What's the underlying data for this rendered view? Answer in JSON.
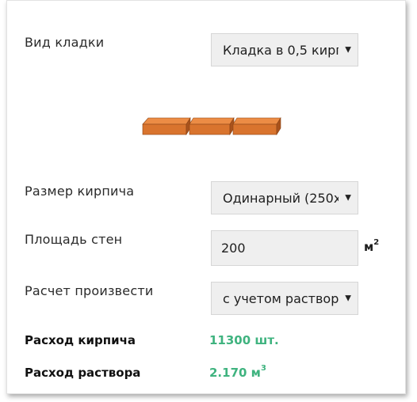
{
  "form": {
    "masonry_type": {
      "label": "Вид кладки",
      "selected": "Кладка в 0,5 кирп"
    },
    "brick_size": {
      "label": "Размер кирпича",
      "selected": "Одинарный (250х"
    },
    "wall_area": {
      "label": "Площадь стен",
      "value": "200",
      "unit": "м",
      "unit_sup": "2"
    },
    "calculation": {
      "label": "Расчет произвести",
      "selected": "с учетом раствор"
    }
  },
  "results": {
    "brick_consumption": {
      "label": "Расход кирпича",
      "value": "11300 шт."
    },
    "mortar_consumption": {
      "label": "Расход раствора",
      "value": "2.170 м",
      "value_sup": "3"
    }
  },
  "colors": {
    "result_value": "#3fb37f",
    "brick_face": "#d9742e",
    "brick_top": "#ec8c45",
    "brick_side": "#a9521c",
    "control_bg": "#efefef"
  },
  "illustration": {
    "icon": "brick-row-icon",
    "brick_count": 3
  }
}
